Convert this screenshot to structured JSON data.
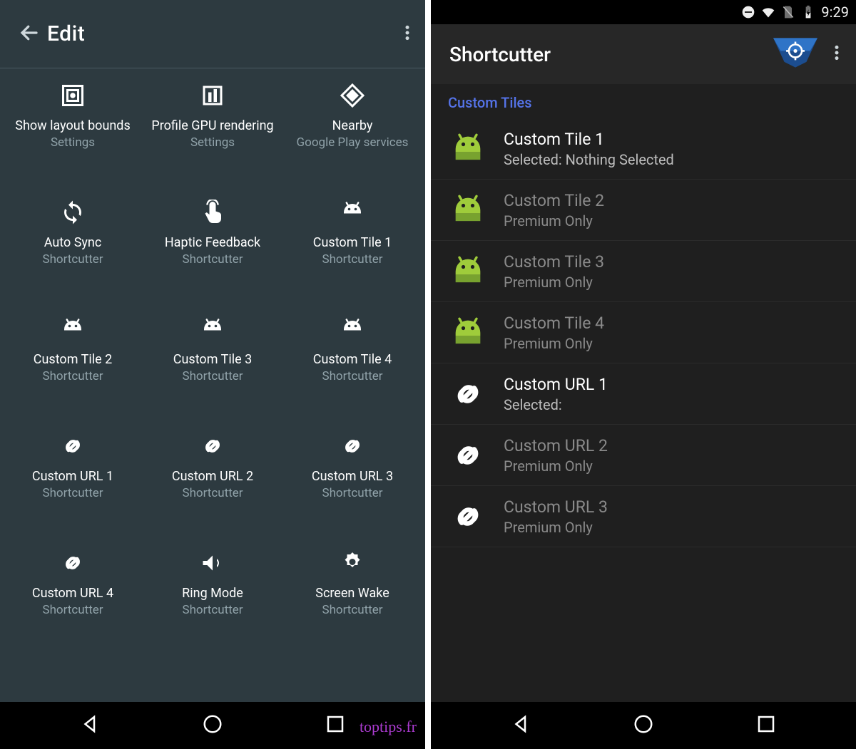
{
  "left": {
    "header_title": "Edit",
    "tiles": [
      {
        "title": "Show layout bounds",
        "sub": "Settings",
        "icon": "layout-bounds-icon"
      },
      {
        "title": "Profile GPU rendering",
        "sub": "Settings",
        "icon": "gpu-profile-icon"
      },
      {
        "title": "Nearby",
        "sub": "Google Play services",
        "icon": "diamond-icon"
      },
      {
        "title": "Auto Sync",
        "sub": "Shortcutter",
        "icon": "sync-icon"
      },
      {
        "title": "Haptic Feedback",
        "sub": "Shortcutter",
        "icon": "touch-icon"
      },
      {
        "title": "Custom Tile 1",
        "sub": "Shortcutter",
        "icon": "android-icon"
      },
      {
        "title": "Custom Tile 2",
        "sub": "Shortcutter",
        "icon": "android-icon"
      },
      {
        "title": "Custom Tile 3",
        "sub": "Shortcutter",
        "icon": "android-icon"
      },
      {
        "title": "Custom Tile 4",
        "sub": "Shortcutter",
        "icon": "android-icon"
      },
      {
        "title": "Custom URL 1",
        "sub": "Shortcutter",
        "icon": "link-icon"
      },
      {
        "title": "Custom URL 2",
        "sub": "Shortcutter",
        "icon": "link-icon"
      },
      {
        "title": "Custom URL 3",
        "sub": "Shortcutter",
        "icon": "link-icon"
      },
      {
        "title": "Custom URL 4",
        "sub": "Shortcutter",
        "icon": "link-icon"
      },
      {
        "title": "Ring Mode",
        "sub": "Shortcutter",
        "icon": "volume-icon"
      },
      {
        "title": "Screen Wake",
        "sub": "Shortcutter",
        "icon": "brightness-icon"
      }
    ]
  },
  "right": {
    "status_time": "9:29",
    "app_title": "Shortcutter",
    "section_header": "Custom Tiles",
    "items": [
      {
        "title": "Custom Tile 1",
        "sub": "Selected: Nothing Selected",
        "icon": "android-green-icon",
        "enabled": true
      },
      {
        "title": "Custom Tile 2",
        "sub": "Premium Only",
        "icon": "android-green-icon",
        "enabled": false
      },
      {
        "title": "Custom Tile 3",
        "sub": "Premium Only",
        "icon": "android-green-icon",
        "enabled": false
      },
      {
        "title": "Custom Tile 4",
        "sub": "Premium Only",
        "icon": "android-green-icon",
        "enabled": false
      },
      {
        "title": "Custom URL 1",
        "sub": "Selected:",
        "icon": "link-white-icon",
        "enabled": true
      },
      {
        "title": "Custom URL 2",
        "sub": "Premium Only",
        "icon": "link-white-icon",
        "enabled": false
      },
      {
        "title": "Custom URL 3",
        "sub": "Premium Only",
        "icon": "link-white-icon",
        "enabled": false
      }
    ]
  },
  "watermark": "toptips.fr"
}
